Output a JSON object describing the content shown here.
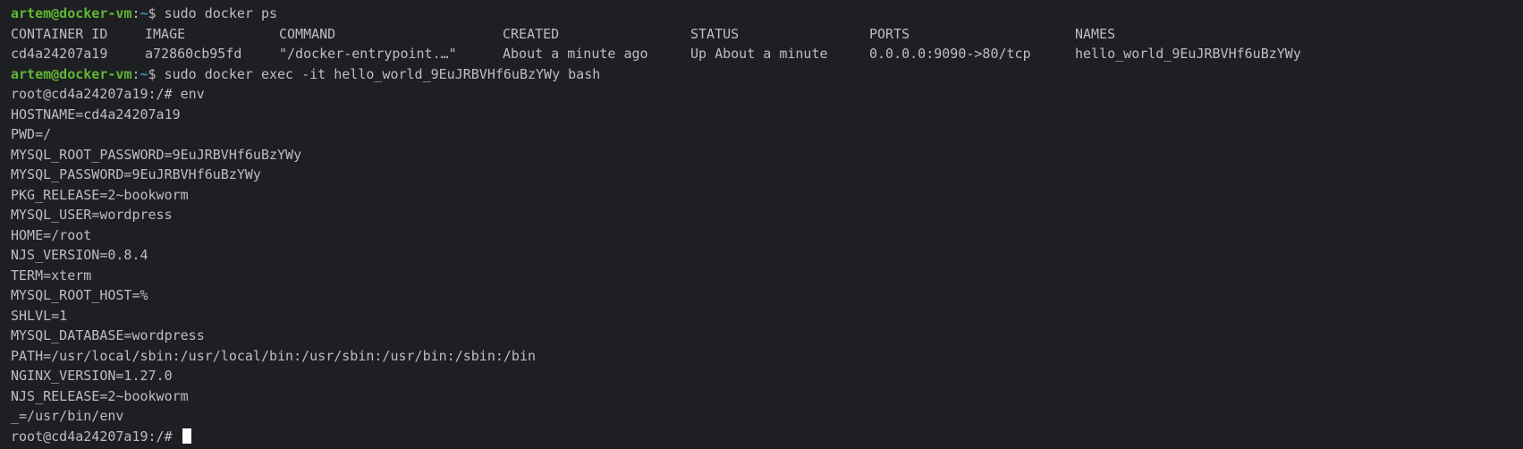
{
  "session": {
    "user_host": "artem@docker-vm",
    "path": "~",
    "prompt_symbol": "$",
    "root_prompt": "root@cd4a24207a19:/#"
  },
  "commands": {
    "ps": "sudo docker ps",
    "exec": "sudo docker exec -it hello_world_9EuJRBVHf6uBzYWy bash",
    "env": "env"
  },
  "ps_table": {
    "headers": [
      "CONTAINER ID",
      "IMAGE",
      "COMMAND",
      "CREATED",
      "STATUS",
      "PORTS",
      "NAMES"
    ],
    "rows": [
      [
        "cd4a24207a19",
        "a72860cb95fd",
        "\"/docker-entrypoint.…\"",
        "About a minute ago",
        "Up About a minute",
        "0.0.0.0:9090->80/tcp",
        "hello_world_9EuJRBVHf6uBzYWy"
      ]
    ]
  },
  "env_output": [
    "HOSTNAME=cd4a24207a19",
    "PWD=/",
    "MYSQL_ROOT_PASSWORD=9EuJRBVHf6uBzYWy",
    "MYSQL_PASSWORD=9EuJRBVHf6uBzYWy",
    "PKG_RELEASE=2~bookworm",
    "MYSQL_USER=wordpress",
    "HOME=/root",
    "NJS_VERSION=0.8.4",
    "TERM=xterm",
    "MYSQL_ROOT_HOST=%",
    "SHLVL=1",
    "MYSQL_DATABASE=wordpress",
    "PATH=/usr/local/sbin:/usr/local/bin:/usr/sbin:/usr/bin:/sbin:/bin",
    "NGINX_VERSION=1.27.0",
    "NJS_RELEASE=2~bookworm",
    "_=/usr/bin/env"
  ],
  "colors": {
    "background": "#1e1f22",
    "text": "#bcbec4",
    "user_host": "#5fb832",
    "path": "#3592c4",
    "cursor": "#ffffff"
  }
}
